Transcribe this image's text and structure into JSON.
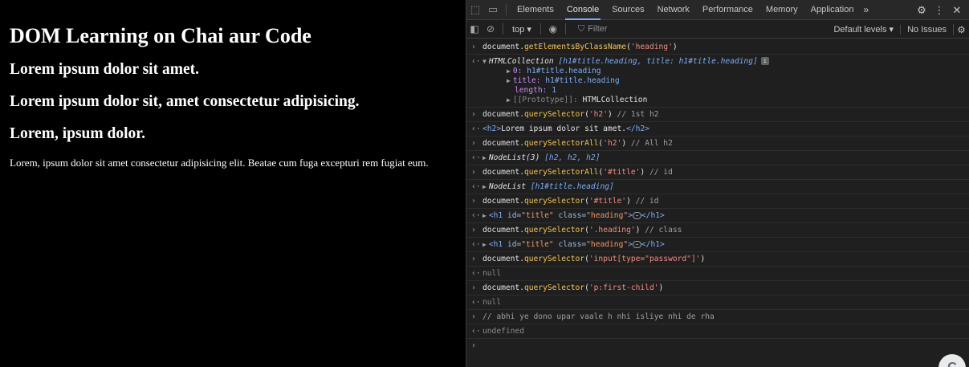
{
  "page": {
    "h1": "DOM Learning on Chai aur Code",
    "h2_1": "Lorem ipsum dolor sit amet.",
    "h2_2": "Lorem ipsum dolor sit, amet consectetur adipisicing.",
    "h2_3": "Lorem, ipsum dolor.",
    "paragraph": "Lorem, ipsum dolor sit amet consectetur adipisicing elit. Beatae cum fuga excepturi rem fugiat eum."
  },
  "devtools": {
    "tabs": [
      "Elements",
      "Console",
      "Sources",
      "Network",
      "Performance",
      "Memory",
      "Application"
    ],
    "active_tab": "Console",
    "more_tabs": "»",
    "context": "top ▾",
    "filter_placeholder": "Filter",
    "default_levels": "Default levels ▾",
    "issues": "No Issues",
    "icons": {
      "inspect": "inspect-element-icon",
      "device": "device-toolbar-icon",
      "settings": "gear-icon",
      "kebab": "more-vert-icon",
      "close": "close-icon",
      "sidebar": "sidebar-toggle-icon",
      "clear": "clear-console-icon",
      "eye": "live-expression-icon",
      "filter": "filter-icon"
    },
    "colors": {
      "accent": "#7cacf8",
      "string": "#f28b82",
      "method": "#f5c451"
    }
  },
  "console": {
    "l1": {
      "obj": "document",
      "meth": "getElementsByClassName",
      "arg": "'heading'"
    },
    "l2": {
      "head_type": "HTMLCollection",
      "head_rest": "[h1#title.heading, title: h1#title.heading]",
      "item0_key": "0:",
      "item0_val": "h1#title.heading",
      "title_key": "title:",
      "title_val": "h1#title.heading",
      "length_key": "length:",
      "length_val": "1",
      "proto_key": "[[Prototype]]:",
      "proto_val": "HTMLCollection"
    },
    "l3": {
      "obj": "document",
      "meth": "querySelector",
      "arg": "'h2'",
      "comment": "// 1st h2"
    },
    "l4": {
      "open": "<h2>",
      "text": "Lorem ipsum dolor sit amet.",
      "close": "</h2>"
    },
    "l5": {
      "obj": "document",
      "meth": "querySelectorAll",
      "arg": "'h2'",
      "comment": "// All h2"
    },
    "l6": {
      "type": "NodeList(3)",
      "rest": "[h2, h2, h2]"
    },
    "l7": {
      "obj": "document",
      "meth": "querySelectorAll",
      "arg": "'#title'",
      "comment": "// id"
    },
    "l8": {
      "type": "NodeList",
      "rest": "[h1#title.heading]"
    },
    "l9": {
      "obj": "document",
      "meth": "querySelector",
      "arg": "'#title'",
      "comment": "// id"
    },
    "l10": {
      "tag_open": "<h1",
      "id_attr": "id=",
      "id_val": "\"title\"",
      "class_attr": "class=",
      "class_val": "\"heading\"",
      "gt": ">",
      "ell": "…",
      "tag_close": "</h1>"
    },
    "l11": {
      "obj": "document",
      "meth": "querySelector",
      "arg": "'.heading'",
      "comment": "// class"
    },
    "l12": {
      "tag_open": "<h1",
      "id_attr": "id=",
      "id_val": "\"title\"",
      "class_attr": "class=",
      "class_val": "\"heading\"",
      "gt": ">",
      "ell": "…",
      "tag_close": "</h1>"
    },
    "l13": {
      "obj": "document",
      "meth": "querySelector",
      "arg": "'input[type=\"password\"]'"
    },
    "l14": "null",
    "l15": {
      "obj": "document",
      "meth": "querySelector",
      "arg": "'p:first-child'"
    },
    "l16": "null",
    "l17": "// abhi ye dono upar vaale h nhi isliye nhi de rha",
    "l18": "undefined",
    "fab": "C"
  }
}
